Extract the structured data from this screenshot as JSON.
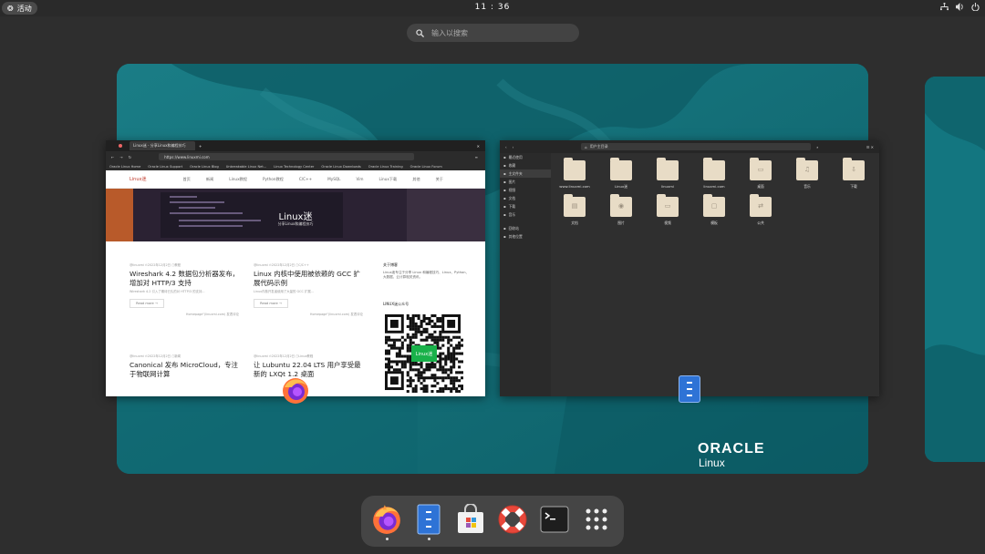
{
  "topbar": {
    "activities_label": "活动",
    "clock": "11 : 36",
    "tray_icons": [
      "network-icon",
      "volume-icon",
      "power-icon"
    ]
  },
  "search": {
    "placeholder": "输入以搜索"
  },
  "workspace": {
    "brand_line1": "ORACLE",
    "brand_line2": "Linux"
  },
  "browser": {
    "tab_title": "Linux迷 - 分享Linux和编程技巧",
    "url": "https://www.linuxmi.com",
    "bookmarks": [
      "Oracle Linux Home",
      "Oracle Linux Support",
      "Oracle Linux Blog",
      "Unbreakable Linux Net...",
      "Linux Technology Center",
      "Oracle Linux Downloads",
      "Oracle Linux Training",
      "Oracle Linux Forum"
    ],
    "site": {
      "logo": "Linux迷",
      "nav": [
        "首页",
        "新闻",
        "Linux教程",
        "Python教程",
        "C/C++",
        "MySQL",
        "Vim",
        "Linux下载",
        "其他",
        "关于"
      ],
      "hero_title": "Linux迷",
      "hero_subtitle": "分享Linux和编程技巧",
      "posts": [
        {
          "meta": "@linuxmi  ⊙2022年12月2日  ▢教程",
          "title": "Wireshark 4.2 数据包分析器发布，增加对 HTTP/3 支持",
          "excerpt": "Wireshark 4.2 引入了期待已久的对 HTTP/3 的支持...",
          "more": "Read more →",
          "footer": "Homepage\"(linuxmi.com)  发表评论"
        },
        {
          "meta": "@linuxmi  ⊙2022年12月2日  ▢C/C++",
          "title": "Linux 内核中使用被依赖的 GCC 扩展代码示例",
          "excerpt": "Linux内核开发者使用了大量的 GCC 扩展...",
          "more": "Read more →",
          "footer": "Homepage\"(linuxmi.com)  发表评论"
        },
        {
          "meta": "@linuxmi  ⊙2022年12月2日  ▢新闻",
          "title": "Canonical 发布 MicroCloud，专注于物联网计算",
          "excerpt": "",
          "more": "",
          "footer": ""
        },
        {
          "meta": "@linuxmi  ⊙2022年12月2日  ▢Linux教程",
          "title": "让 Lubuntu 22.04 LTS 用户享受最新的 LXQt 1.2 桌面",
          "excerpt": "",
          "more": "",
          "footer": ""
        }
      ],
      "about_heading": "关于博客",
      "about_text": "Linux迷专注于分享 Linux 和编程技巧、Linux、Python、大数据、云计算相关资讯。",
      "qr_heading": "LINUX迷公众号",
      "qr_label": "Linux迷"
    }
  },
  "files": {
    "path": "用户主目录",
    "sidebar": [
      "最近使用",
      "收藏",
      "主文件夹",
      "图片",
      "视频",
      "文档",
      "下载",
      "音乐",
      "回收站",
      "其他位置"
    ],
    "items": [
      {
        "label": "www.linuxmi.com",
        "glyph": ""
      },
      {
        "label": "Linux迷",
        "glyph": ""
      },
      {
        "label": "linuxmi",
        "glyph": ""
      },
      {
        "label": "linuxmi.com",
        "glyph": ""
      },
      {
        "label": "桌面",
        "glyph": "▭"
      },
      {
        "label": "音乐",
        "glyph": "♫"
      },
      {
        "label": "下载",
        "glyph": "⇩"
      },
      {
        "label": "文档",
        "glyph": "▤"
      },
      {
        "label": "图片",
        "glyph": "◉"
      },
      {
        "label": "视频",
        "glyph": "▭"
      },
      {
        "label": "模板",
        "glyph": "▢"
      },
      {
        "label": "公共",
        "glyph": "⇄"
      }
    ]
  },
  "dock": {
    "apps": [
      "firefox",
      "files",
      "software",
      "help",
      "terminal",
      "app-grid"
    ],
    "running": [
      "firefox",
      "files"
    ]
  }
}
